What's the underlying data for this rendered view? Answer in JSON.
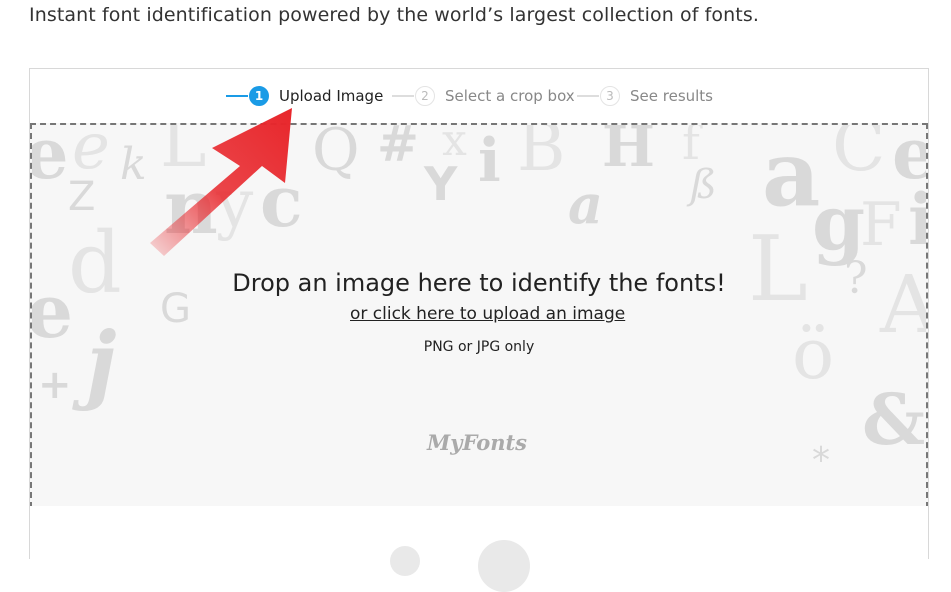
{
  "tagline": "Instant font identification powered by the world’s largest collection of fonts.",
  "steps": [
    {
      "num": "1",
      "label": "Upload Image",
      "active": true
    },
    {
      "num": "2",
      "label": "Select a crop box",
      "active": false
    },
    {
      "num": "3",
      "label": "See results",
      "active": false
    }
  ],
  "dropzone": {
    "title": "Drop an image here to identify the fonts!",
    "link": "or click here to upload an image",
    "formats": "PNG or JPG only",
    "logo": "MyFonts"
  },
  "colors": {
    "accent": "#1a9be6",
    "arrow": "#e8262b",
    "dash_border": "#777777"
  },
  "icons": [
    "red-arrow-annotation-icon"
  ]
}
